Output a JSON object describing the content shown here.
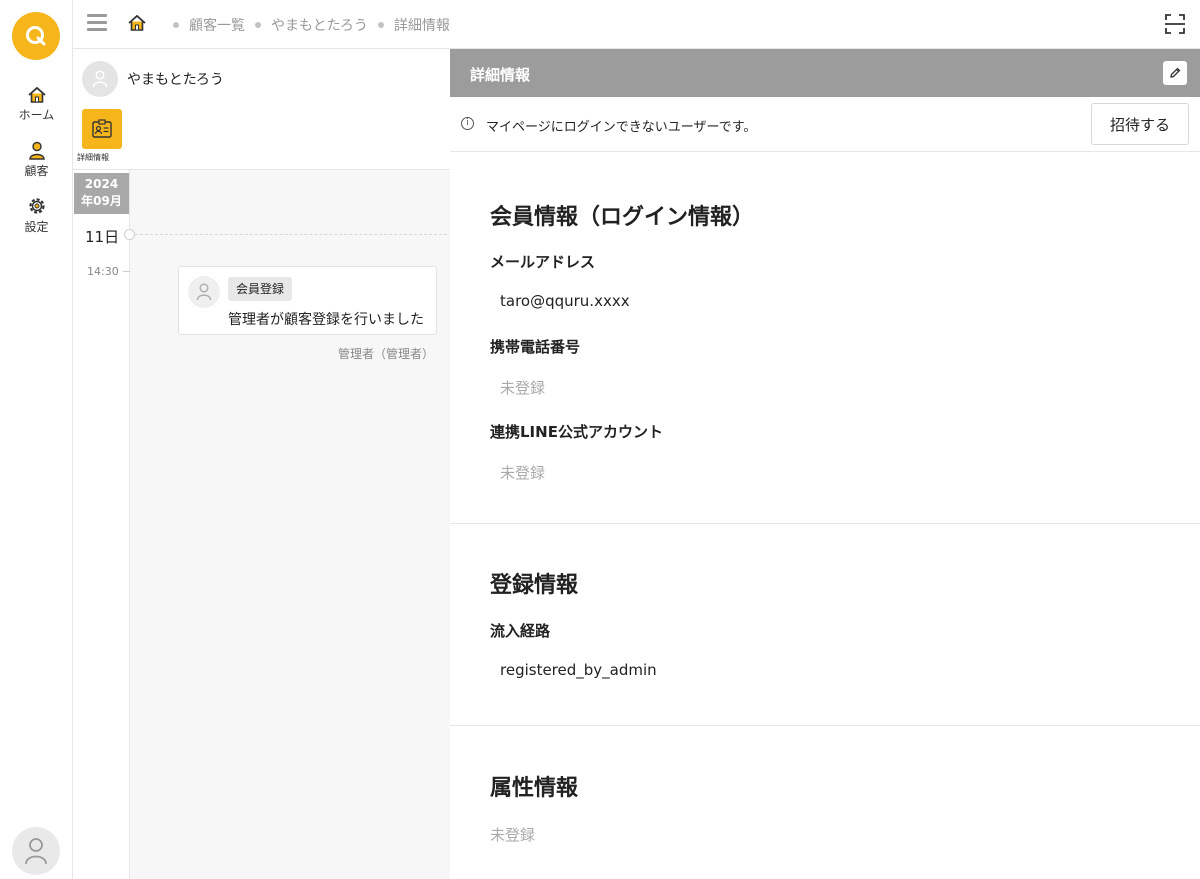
{
  "nav": {
    "items": [
      {
        "label": "ホーム",
        "icon": "home-icon"
      },
      {
        "label": "顧客",
        "icon": "person-icon"
      },
      {
        "label": "設定",
        "icon": "gear-icon"
      }
    ]
  },
  "breadcrumb": [
    "顧客一覧",
    "やまもとたろう",
    "詳細情報"
  ],
  "customer": {
    "name": "やまもとたろう",
    "tab_label": "詳細情報"
  },
  "timeline": {
    "year": "2024",
    "month": "年09月",
    "day": "11日",
    "time": "14:30",
    "event": {
      "tag": "会員登録",
      "text": "管理者が顧客登録を行いました",
      "by": "管理者（管理者）"
    }
  },
  "panel": {
    "title": "詳細情報",
    "notice": "マイページにログインできないユーザーです。",
    "invite_label": "招待する"
  },
  "sections": {
    "member": {
      "title": "会員情報（ログイン情報）",
      "email_label": "メールアドレス",
      "email_value": "taro@qquru.xxxx",
      "phone_label": "携帯電話番号",
      "phone_value": "未登録",
      "line_label": "連携LINE公式アカウント",
      "line_value": "未登録"
    },
    "registration": {
      "title": "登録情報",
      "route_label": "流入経路",
      "route_value": "registered_by_admin"
    },
    "attributes": {
      "title": "属性情報",
      "value": "未登録"
    }
  },
  "colors": {
    "accent": "#f5b51b",
    "panel_header": "#9c9c9c",
    "muted_text": "#aaaaaa"
  }
}
